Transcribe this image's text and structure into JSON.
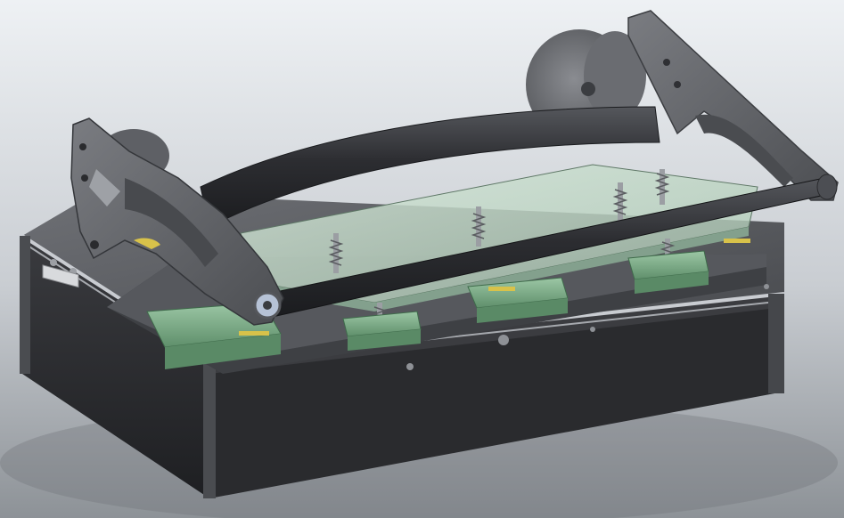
{
  "scene": {
    "description_label": "",
    "colors": {
      "background_top": "#e9ecf0",
      "background_bottom": "#8f9499",
      "housing_dark": "#2b2b2e",
      "housing_top": "#5a5c60",
      "plate_gray": "#6b6d72",
      "arm_gray": "#5e6065",
      "pcb_green": "#7fae8a",
      "pcb_green_dark": "#4f7d5c",
      "clear_cover": "#bcd4c2",
      "bar_black": "#2f3034",
      "accent_yellow": "#d8c24a",
      "metal_light": "#c9ccd1"
    },
    "fixture_count": 4
  }
}
